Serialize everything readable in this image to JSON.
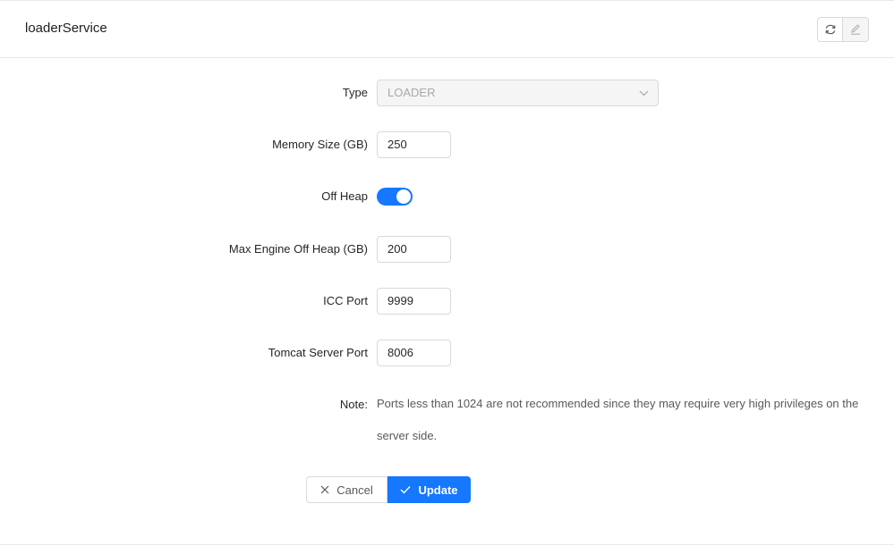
{
  "header": {
    "title": "loaderService",
    "refresh_icon": "refresh-icon",
    "edit_icon": "edit-icon"
  },
  "form": {
    "type": {
      "label": "Type",
      "value": "LOADER",
      "icon": "chevron-down-icon"
    },
    "memory_size": {
      "label": "Memory Size (GB)",
      "value": "250"
    },
    "off_heap": {
      "label": "Off Heap",
      "checked": true
    },
    "max_engine_off_heap": {
      "label": "Max Engine Off Heap (GB)",
      "value": "200"
    },
    "icc_port": {
      "label": "ICC Port",
      "value": "9999"
    },
    "tomcat_server_port": {
      "label": "Tomcat Server Port",
      "value": "8006"
    },
    "note": {
      "label": "Note:",
      "text": "Ports less than 1024 are not recommended since they may require very high privileges on the server side."
    }
  },
  "actions": {
    "cancel_label": "Cancel",
    "update_label": "Update"
  },
  "colors": {
    "primary": "#1677ff",
    "border": "#d9d9d9",
    "disabled_bg": "#f5f5f5"
  }
}
